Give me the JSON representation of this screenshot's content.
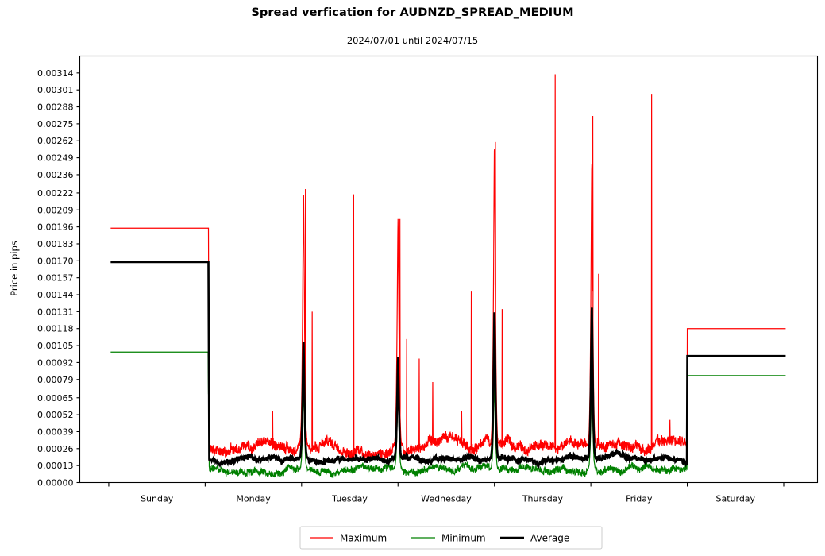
{
  "chart_data": {
    "type": "line",
    "title": "Spread verfication for AUDNZD_SPREAD_MEDIUM",
    "subtitle": "2024/07/01 until 2024/07/15",
    "xlabel": "",
    "ylabel": "Price in pips",
    "grid": false,
    "legend_position": "bottom-center",
    "ylim": [
      0.0,
      0.00327
    ],
    "ytick_labels": [
      "0.00000",
      "0.00013",
      "0.00026",
      "0.00039",
      "0.00052",
      "0.00065",
      "0.00079",
      "0.00092",
      "0.00105",
      "0.00118",
      "0.00131",
      "0.00144",
      "0.00157",
      "0.00170",
      "0.00183",
      "0.00196",
      "0.00209",
      "0.00222",
      "0.00236",
      "0.00249",
      "0.00262",
      "0.00275",
      "0.00288",
      "0.00301",
      "0.00314"
    ],
    "ytick_values": [
      0.0,
      0.00013,
      0.00026,
      0.00039,
      0.00052,
      0.00065,
      0.00079,
      0.00092,
      0.00105,
      0.00118,
      0.00131,
      0.00144,
      0.00157,
      0.0017,
      0.00183,
      0.00196,
      0.00209,
      0.00222,
      0.00236,
      0.00249,
      0.00262,
      0.00275,
      0.00288,
      0.00301,
      0.00314
    ],
    "xtick_labels": [
      "Sunday",
      "Monday",
      "Tuesday",
      "Wednesday",
      "Thursday",
      "Friday",
      "Saturday"
    ],
    "xtick_boundaries": [
      0.3,
      1.3,
      2.3,
      3.3,
      4.3,
      5.3,
      6.3,
      7.3
    ],
    "xlim": [
      0.0,
      7.65
    ],
    "legend": [
      {
        "name": "Maximum",
        "color": "#ff0000",
        "width": 1.2
      },
      {
        "name": "Minimum",
        "color": "#008000",
        "width": 1.2
      },
      {
        "name": "Average",
        "color": "#000000",
        "width": 2.6
      }
    ],
    "series": [
      {
        "name": "Maximum",
        "color": "#ff0000",
        "width": 1.2
      },
      {
        "name": "Minimum",
        "color": "#008000",
        "width": 1.2
      },
      {
        "name": "Average",
        "color": "#000000",
        "width": 2.6
      }
    ],
    "weekend_levels": {
      "sunday": {
        "maximum": 0.00195,
        "average": 0.00169,
        "minimum": 0.001,
        "x_start": 0.32,
        "x_end": 1.33
      },
      "saturday": {
        "maximum": 0.00118,
        "average": 0.00097,
        "minimum": 0.00082,
        "x_start": 6.3,
        "x_end": 7.32
      }
    },
    "session_baseline": {
      "maximum": 0.00028,
      "average": 0.00018,
      "minimum": 0.0001,
      "noise_amplitude": {
        "maximum": 4.5e-05,
        "average": 2.2e-05,
        "minimum": 3e-05
      }
    },
    "session_open_bumps": [
      {
        "day": "Monday",
        "x": 1.33,
        "maximum": 0.00195,
        "average": 0.00169,
        "minimum": 0.00068
      },
      {
        "day": "Tuesday",
        "x": 2.32,
        "maximum": 0.00225,
        "average": 0.0011,
        "minimum": 0.00072
      },
      {
        "day": "Wednesday",
        "x": 3.3,
        "maximum": 0.00202,
        "average": 0.00096,
        "minimum": 0.00073
      },
      {
        "day": "Thursday",
        "x": 4.3,
        "maximum": 0.00261,
        "average": 0.00133,
        "minimum": 0.00076
      },
      {
        "day": "Friday",
        "x": 5.31,
        "maximum": 0.00248,
        "average": 0.00136,
        "minimum": 0.00079
      },
      {
        "day": "Saturday",
        "x": 6.3,
        "maximum": 0.00118,
        "average": 0.00097,
        "minimum": 0.00082
      }
    ],
    "spikes": [
      {
        "x": 2.0,
        "value": 0.00055,
        "series": "Maximum"
      },
      {
        "x": 2.34,
        "value": 0.00225,
        "series": "Maximum"
      },
      {
        "x": 2.41,
        "value": 0.00131,
        "series": "Maximum"
      },
      {
        "x": 2.84,
        "value": 0.00221,
        "series": "Maximum"
      },
      {
        "x": 3.32,
        "value": 0.00202,
        "series": "Maximum"
      },
      {
        "x": 3.39,
        "value": 0.0011,
        "series": "Maximum"
      },
      {
        "x": 3.52,
        "value": 0.00095,
        "series": "Maximum"
      },
      {
        "x": 3.66,
        "value": 0.00077,
        "series": "Maximum"
      },
      {
        "x": 3.96,
        "value": 0.00055,
        "series": "Maximum"
      },
      {
        "x": 4.06,
        "value": 0.00147,
        "series": "Maximum"
      },
      {
        "x": 4.31,
        "value": 0.00261,
        "series": "Maximum"
      },
      {
        "x": 4.38,
        "value": 0.00133,
        "series": "Maximum"
      },
      {
        "x": 4.93,
        "value": 0.00313,
        "series": "Maximum"
      },
      {
        "x": 5.32,
        "value": 0.00281,
        "series": "Maximum"
      },
      {
        "x": 5.38,
        "value": 0.0016,
        "series": "Maximum"
      },
      {
        "x": 5.93,
        "value": 0.00298,
        "series": "Maximum"
      },
      {
        "x": 6.12,
        "value": 0.00048,
        "series": "Maximum"
      }
    ],
    "annotations": []
  },
  "figure": {
    "background": "#ffffff",
    "frame_color": "#000000"
  }
}
